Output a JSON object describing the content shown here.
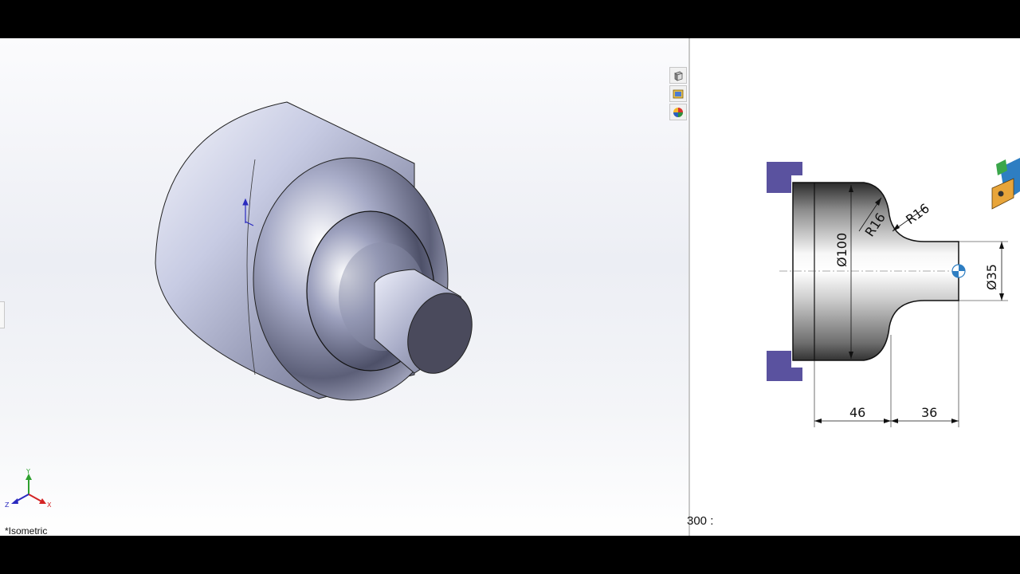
{
  "viewport": {
    "view_label": "*Isometric",
    "triad": {
      "x": "X",
      "y": "Y",
      "z": "Z"
    },
    "hud_buttons": [
      {
        "name": "view-orientation-button",
        "icon": "cube-icon"
      },
      {
        "name": "display-style-button",
        "icon": "display-style-icon"
      },
      {
        "name": "appearance-button",
        "icon": "appearance-icon"
      }
    ]
  },
  "drawing": {
    "dims": {
      "dia_large": "Ø100",
      "dia_small": "Ø35",
      "r1": "R16",
      "r2": "R16",
      "len1": "46",
      "len2": "36"
    },
    "note": "300 :"
  },
  "colors": {
    "chuck": "#5a529f",
    "body_light": "#ffffff",
    "body_dark": "#8e8e96",
    "tool": "#2e7ec2"
  }
}
